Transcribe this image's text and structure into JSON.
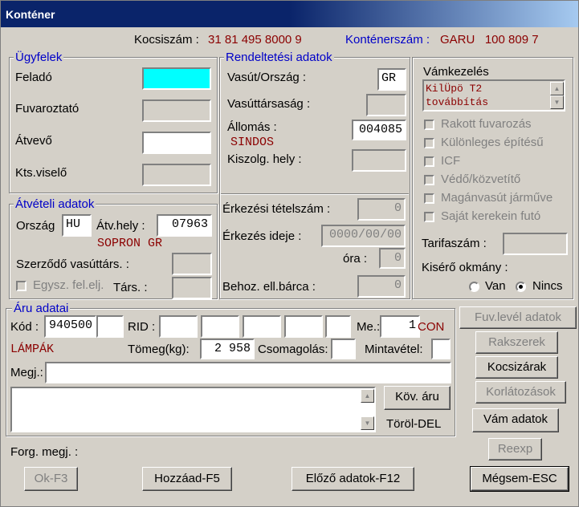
{
  "window": {
    "title": "Konténer"
  },
  "header": {
    "kocsiszam_label": "Kocsiszám :",
    "kocsiszam_value": "31 81 495 8000 9",
    "kontenerszam_label": "Konténerszám :",
    "kontenerszam_value": "GARU   100 809 7"
  },
  "ugyfelek": {
    "title": "Ügyfelek",
    "felado": "Feladó",
    "fuvaroztato": "Fuvaroztató",
    "atvevo": "Átvevő",
    "ktsviselo": "Kts.viselő"
  },
  "rendeltetesi": {
    "title": "Rendeltetési adatok",
    "vasut_orszag_label": "Vasút/Ország :",
    "vasut_orszag_value": "GR",
    "vasuttarsasag_label": "Vasúttársaság :",
    "allomas_label": "Állomás :",
    "allomas_value": "004085",
    "allomas_name": "SINDOS",
    "kiszolg_label": "Kiszolg. hely :",
    "erkezesi_tetel_label": "Érkezési tételszám :",
    "erkezesi_tetel_value": "0",
    "erkezes_ideje_label": "Érkezés ideje :",
    "erkezes_ideje_value": "0000/00/00",
    "ora_label": "óra :",
    "ora_value": "0",
    "behoz_label": "Behoz. ell.bárca :",
    "behoz_value": "0"
  },
  "atveteli": {
    "title": "Átvételi adatok",
    "orszag_label": "Ország",
    "orszag_value": "HU",
    "atvhely_label": "Átv.hely :",
    "atvhely_value": "07963",
    "atvhely_name": "SOPRON GR",
    "szerzodo_label": "Szerződő vasúttárs. :",
    "egysz_label": "Egysz. fel.elj.",
    "tars_label": "Társ. :"
  },
  "vam": {
    "vamkezeles_label": "Vámkezelés",
    "vamkezeles_text_1": "KilÜpö T2",
    "vamkezeles_text_2": "továbbítás",
    "checks": [
      "Rakott fuvarozás",
      "Különleges építésű",
      "ICF",
      "Védő/közvetítő",
      "Magánvasút járműve",
      "Saját kerekein futó"
    ],
    "tarifaszam_label": "Tarifaszám :",
    "kisero_label": "Kisérő okmány :",
    "van_label": "Van",
    "nincs_label": "Nincs"
  },
  "aru": {
    "title": "Áru adatai",
    "kod_label": "Kód :",
    "kod_value": "940500",
    "rid_label": "RID :",
    "me_label": "Me.:",
    "me_value": "1",
    "me_unit": "CON",
    "aru_name": "LÁMPÁK",
    "tomeg_label": "Tömeg(kg):",
    "tomeg_value": "2 958",
    "csomagolas_label": "Csomagolás:",
    "mintavetel_label": "Mintavétel:",
    "megj_label": "Megj.:",
    "kov_aru_label": "Köv. áru",
    "torol_label": "Töröl-DEL"
  },
  "side_buttons": {
    "fuvlevel": "Fuv.levél adatok",
    "rakszerek": "Rakszerek",
    "kocsizarak": "Kocsizárak",
    "korlatozasok": "Korlátozások",
    "vam_adatok": "Vám adatok",
    "reexp": "Reexp"
  },
  "footer": {
    "forg_megj_label": "Forg. megj. :",
    "ok": "Ok-F3",
    "hozzaad": "Hozzáad-F5",
    "elozo": "Előző adatok-F12",
    "megsem": "Mégsem-ESC"
  }
}
